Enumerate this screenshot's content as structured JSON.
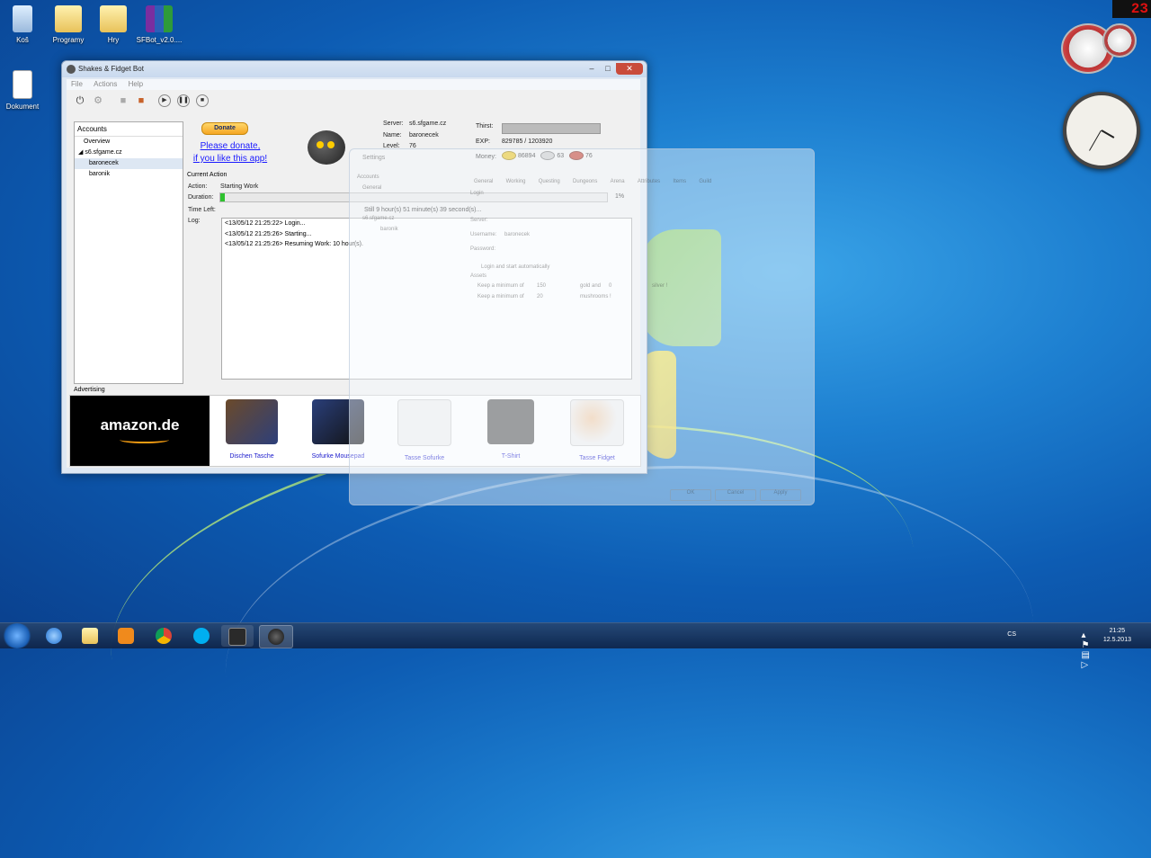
{
  "desktop": {
    "icons": [
      {
        "label": "Koš"
      },
      {
        "label": "Programy"
      },
      {
        "label": "Hry"
      },
      {
        "label": "SFBot_v2.0...."
      },
      {
        "label": "Dokument"
      }
    ],
    "gadget_counter": "23"
  },
  "window": {
    "title": "Shakes & Fidget Bot",
    "menu": [
      "File",
      "Actions",
      "Help"
    ],
    "accounts": {
      "header": "Accounts",
      "items": [
        "Overview",
        "s6.sfgame.cz",
        "baronecek",
        "baronik"
      ]
    },
    "donate": {
      "button": "Donate",
      "link_line1": "Please donate,",
      "link_line2": "if you like this app!"
    },
    "info": {
      "server_label": "Server:",
      "server": "s6.sfgame.cz",
      "name_label": "Name:",
      "name": "baronecek",
      "level_label": "Level:",
      "level": "76",
      "thirst_label": "Thirst:",
      "exp_label": "EXP:",
      "exp": "829785 / 1203920",
      "money_label": "Money:",
      "gold": "86894",
      "silver": "63",
      "mushrooms": "76"
    },
    "current_action": {
      "title": "Current Action",
      "action_label": "Action:",
      "action": "Starting Work",
      "duration_label": "Duration:",
      "duration_percent": "1%",
      "duration_fraction": 0.01,
      "timeleft_label": "Time Left:",
      "timeleft": "Still 9 hour(s) 51 minute(s) 39 second(s)...",
      "log_label": "Log:",
      "log": [
        "<13/05/12 21:25:22> Login...",
        "<13/05/12 21:25:26> Starting...",
        "<13/05/12 21:25:26> Resuming Work: 10 hour(s)."
      ]
    },
    "advertising": {
      "label": "Advertising",
      "brand": "amazon.de",
      "products": [
        "Dischen Tasche",
        "Sofurke Mousepad",
        "Tasse Sofurke",
        "T-Shirt",
        "Tasse Fidget"
      ]
    }
  },
  "settings": {
    "title": "Settings",
    "tree": [
      "Accounts",
      "General",
      "s6.sfgame.cz",
      "baronik"
    ],
    "tabs": [
      "General",
      "Working",
      "Questing",
      "Dungeons",
      "Arena",
      "Attributes",
      "Items",
      "Guild"
    ],
    "fields": {
      "login": "Login",
      "server_label": "Server:",
      "username_label": "Username:",
      "username": "baronecek",
      "password_label": "Password:",
      "autostart": "Login and start automatically",
      "assets": "Assets",
      "keep1": "Keep a minimum of",
      "keep1_gold": "150",
      "gold_and": "gold and",
      "keep1_silver": "0",
      "silver": "silver !",
      "keep2": "Keep a minimum of",
      "keep2_val": "20",
      "mushrooms": "mushrooms !"
    },
    "buttons": [
      "OK",
      "Cancel",
      "Apply"
    ]
  },
  "taskbar": {
    "lang": "CS",
    "time": "21:25",
    "date": "12.5.2013"
  }
}
